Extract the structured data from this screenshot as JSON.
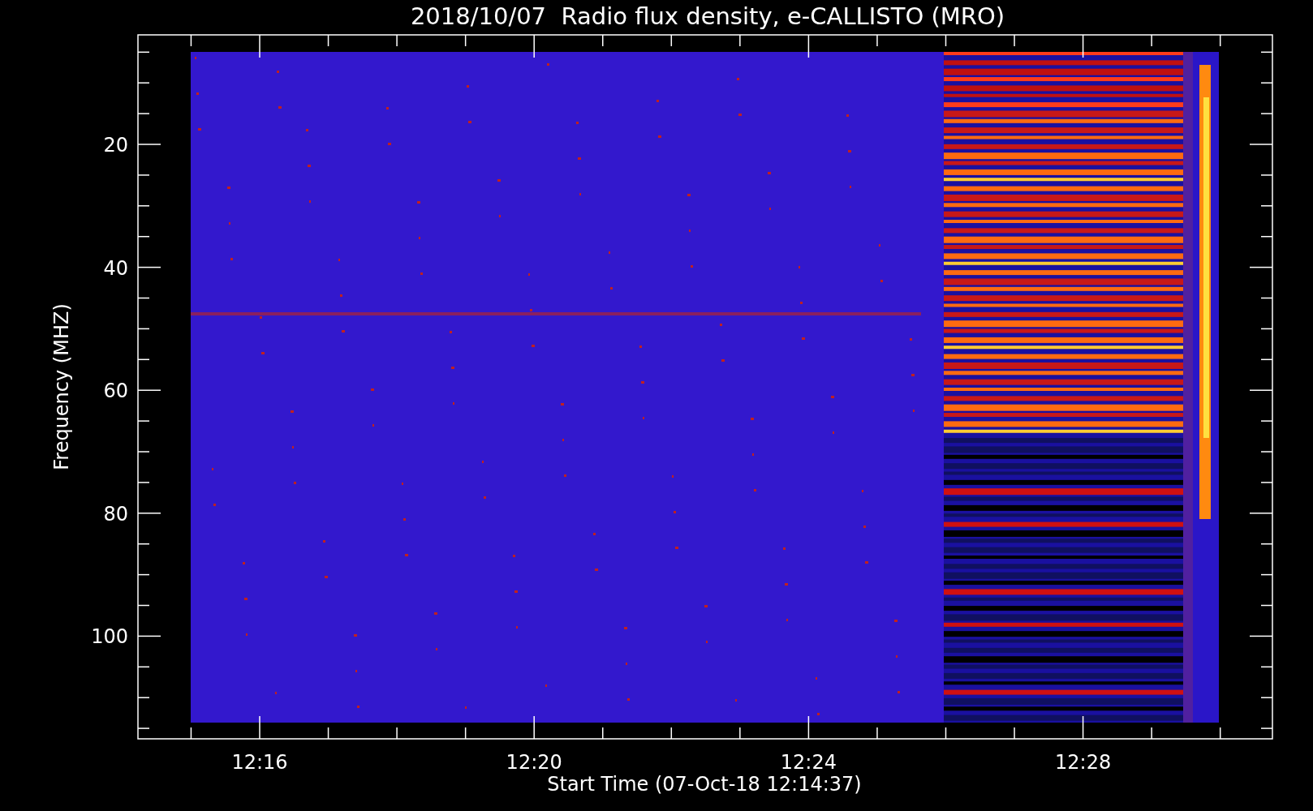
{
  "title": "2018/10/07  Radio flux density, e-CALLISTO (MRO)",
  "y_axis": {
    "label": "Frequency (MHZ)",
    "ticks": [
      "20",
      "40",
      "60",
      "80",
      "100"
    ]
  },
  "x_axis": {
    "label": "Start Time (07-Oct-18 12:14:37)",
    "ticks": [
      "12:16",
      "12:20",
      "12:24",
      "12:28"
    ]
  }
}
